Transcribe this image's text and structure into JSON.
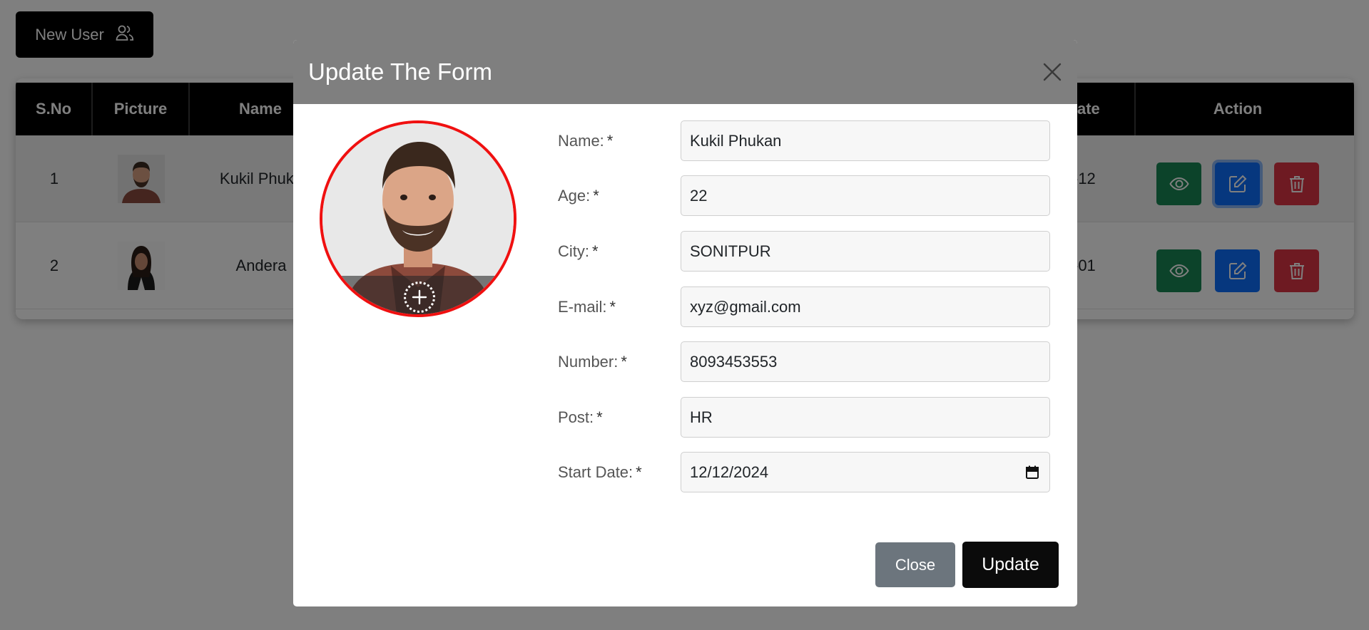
{
  "page": {
    "new_user_label": "New User",
    "new_user_icon": "users-icon"
  },
  "table": {
    "headers": [
      "S.No",
      "Picture",
      "Name",
      "ate",
      "Action"
    ],
    "rows": [
      {
        "sno": "1",
        "name": "Kukil Phuka",
        "date": "-12"
      },
      {
        "sno": "2",
        "name": "Andera",
        "date": "-01"
      }
    ],
    "action_icons": [
      "eye-icon",
      "edit-icon",
      "trash-icon"
    ]
  },
  "modal": {
    "title": "Update The Form",
    "required_mark": "*",
    "fields": [
      {
        "label": "Name:",
        "value": "Kukil Phukan"
      },
      {
        "label": "Age:",
        "value": "22"
      },
      {
        "label": "City:",
        "value": "SONITPUR"
      },
      {
        "label": "E-mail:",
        "value": "xyz@gmail.com"
      },
      {
        "label": "Number:",
        "value": "8093453553"
      },
      {
        "label": "Post:",
        "value": "HR"
      },
      {
        "label": "Start Date:",
        "value": "12/12/2024"
      }
    ],
    "close_label": "Close",
    "update_label": "Update"
  },
  "colors": {
    "avatar_border": "#f01010",
    "view_button": "#198754",
    "edit_button": "#0d6efd",
    "delete_button": "#dc3545",
    "close_button": "#6c757d",
    "update_button": "#0b0b0b",
    "modal_header": "#7f7f7f"
  }
}
